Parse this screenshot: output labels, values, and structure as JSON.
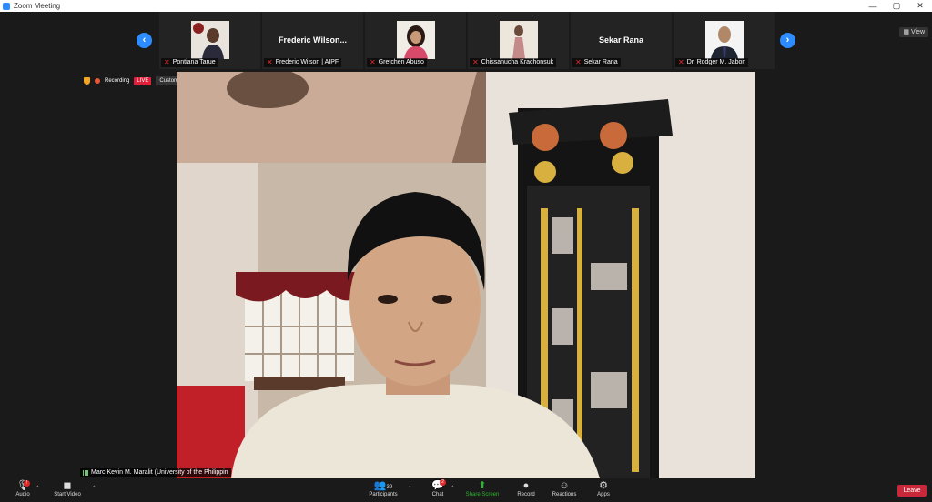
{
  "window": {
    "title": "Zoom Meeting",
    "controls": [
      "—",
      "▢",
      "✕"
    ]
  },
  "view_label": "View",
  "status": {
    "recording_label": "Recording",
    "live_label": "LIVE",
    "stream_service": "Custom Live Streaming Service"
  },
  "gallery": [
    {
      "label": "Pontiana Tarue",
      "has_photo": true
    },
    {
      "label": "Frederic Wilson | AIPF",
      "big_name": "Frederic  Wilson...",
      "has_photo": false
    },
    {
      "label": "Gretchen Abuso",
      "has_photo": true
    },
    {
      "label": "Chissanucha Krachonsuk",
      "has_photo": true
    },
    {
      "label": "Sekar Rana",
      "big_name": "Sekar Rana",
      "has_photo": false
    },
    {
      "label": "Dr. Rodger M. Jabon",
      "has_photo": true
    }
  ],
  "main_speaker": {
    "name": "Marc Kevin M. Maralit (University of the Philippin"
  },
  "toolbar": {
    "audio": "Audio",
    "start_video": "Start Video",
    "participants": "Participants",
    "participants_count": "39",
    "chat": "Chat",
    "chat_badge": "2",
    "share_screen": "Share Screen",
    "record": "Record",
    "reactions": "Reactions",
    "apps": "Apps",
    "leave": "Leave"
  },
  "colors": {
    "accent": "#2d8cff",
    "leave": "#c8283a",
    "share": "#2fb52f"
  }
}
